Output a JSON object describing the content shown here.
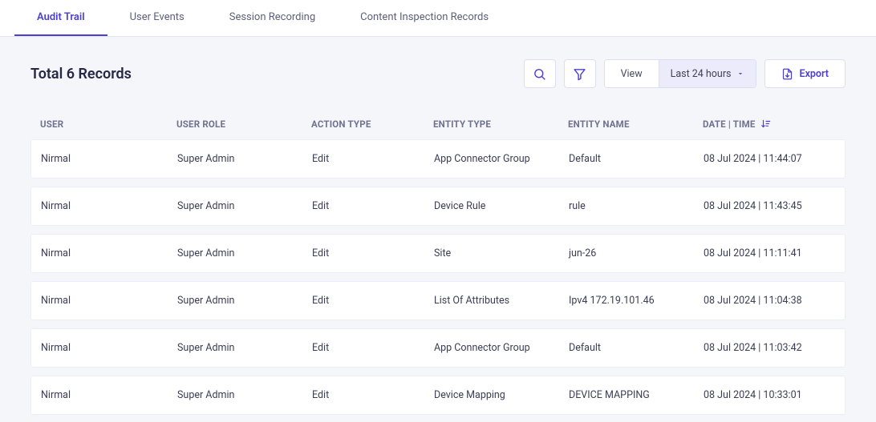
{
  "tabs": [
    {
      "label": "Audit Trail",
      "active": true
    },
    {
      "label": "User Events",
      "active": false
    },
    {
      "label": "Session Recording",
      "active": false
    },
    {
      "label": "Content Inspection Records",
      "active": false
    }
  ],
  "title": "Total 6 Records",
  "controls": {
    "view_label": "View",
    "range_label": "Last 24 hours",
    "export_label": "Export"
  },
  "columns": {
    "user": "USER",
    "role": "USER ROLE",
    "action": "ACTION TYPE",
    "entity_type": "ENTITY TYPE",
    "entity_name": "ENTITY NAME",
    "datetime": "DATE | TIME"
  },
  "rows": [
    {
      "user": "Nirmal",
      "role": "Super Admin",
      "action": "Edit",
      "entity_type": "App Connector Group",
      "entity_name": "Default",
      "datetime": "08 Jul 2024 | 11:44:07"
    },
    {
      "user": "Nirmal",
      "role": "Super Admin",
      "action": "Edit",
      "entity_type": "Device Rule",
      "entity_name": "rule",
      "datetime": "08 Jul 2024 | 11:43:45"
    },
    {
      "user": "Nirmal",
      "role": "Super Admin",
      "action": "Edit",
      "entity_type": "Site",
      "entity_name": "jun-26",
      "datetime": "08 Jul 2024 | 11:11:41"
    },
    {
      "user": "Nirmal",
      "role": "Super Admin",
      "action": "Edit",
      "entity_type": "List Of Attributes",
      "entity_name": "Ipv4 172.19.101.46",
      "datetime": "08 Jul 2024 | 11:04:38"
    },
    {
      "user": "Nirmal",
      "role": "Super Admin",
      "action": "Edit",
      "entity_type": "App Connector Group",
      "entity_name": "Default",
      "datetime": "08 Jul 2024 | 11:03:42"
    },
    {
      "user": "Nirmal",
      "role": "Super Admin",
      "action": "Edit",
      "entity_type": "Device Mapping",
      "entity_name": "DEVICE MAPPING",
      "datetime": "08 Jul 2024 | 10:33:01"
    }
  ]
}
